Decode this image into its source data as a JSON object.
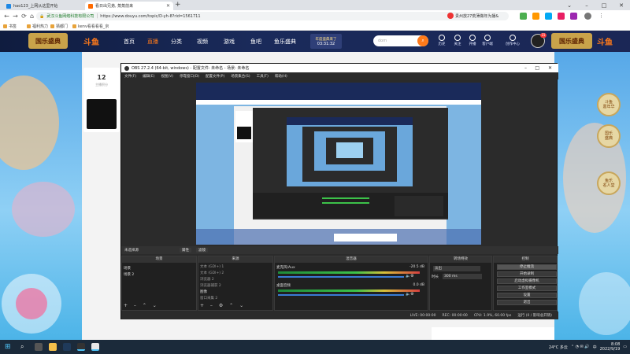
{
  "browser": {
    "tabs": [
      {
        "title": "hao123_上网从这里开始",
        "favicon_color": "#1e88e5",
        "active": false
      },
      {
        "title": "看日出兄弟, 蒸蒸前来",
        "favicon_color": "#ff6a00",
        "active": true
      }
    ],
    "new_tab": "+",
    "window_controls": [
      "⌄",
      "–",
      "□",
      "✕"
    ],
    "nav": {
      "back": "←",
      "forward": "→",
      "reload": "⟳",
      "home": "⌂"
    },
    "site_name": "武汉斗鱼网络科技有限公司",
    "url": "https://www.douyu.com/topic/D-yh-8?rid=1561711",
    "profile_badge": "贵州放27荒薄做年为播&",
    "bookmarks": [
      "书签",
      "福利热力",
      "猜都门",
      "kenv看看看看_京"
    ]
  },
  "douyu": {
    "logo": "斗鱼",
    "event_banner": "国乐盛典",
    "nav_items": [
      "首页",
      "直播",
      "分类",
      "视频",
      "游戏",
      "鱼吧",
      "鱼乐盛典"
    ],
    "promo_title": "年度盛典来了",
    "promo_time": "03:31:32",
    "search_placeholder": "dom",
    "header_icons": [
      {
        "label": "历史"
      },
      {
        "label": "关注"
      },
      {
        "label": "开播"
      },
      {
        "label": "客户端"
      },
      {
        "label": "创作中心"
      }
    ],
    "user_badge": "31",
    "card": {
      "number": "12",
      "label": "主播积分"
    },
    "side_badges": [
      "斗鱼\n嘉年华",
      "国乐\n盛典",
      "鱼乐\n名人堂"
    ]
  },
  "obs": {
    "title": "OBS 27.2.4 (64-bit, windows) - 配置文件: 未命名 - 场景: 未命名",
    "menu": [
      "文件(F)",
      "编辑(E)",
      "视图(V)",
      "停靠窗口(D)",
      "配置文件(P)",
      "场景集合(S)",
      "工具(T)",
      "帮助(H)"
    ],
    "scene_bar": {
      "label": "未选择源",
      "props": "属性",
      "filters": "滤镜"
    },
    "panels": {
      "scenes": {
        "header": "场景",
        "items": [
          "场景",
          "场景 2"
        ]
      },
      "sources": {
        "header": "来源",
        "items": [
          "文本 (GDI+) 1",
          "文本 (GDI+) 2",
          "浏览器 2",
          "浏览器捕获 2",
          "图像",
          "窗口采集 2"
        ]
      },
      "mixer": {
        "header": "混音器",
        "channels": [
          {
            "name": "麦克风/Aux",
            "db": "-20.5 dB"
          },
          {
            "name": "桌面音频",
            "db": "0.0 dB"
          }
        ]
      },
      "transitions": {
        "header": "转场特效",
        "type": "淡出",
        "duration_label": "时长",
        "duration": "300 ms"
      },
      "controls": {
        "header": "控制",
        "buttons": [
          "停止推流",
          "开始录制",
          "启动虚拟摄像机",
          "工作室模式",
          "设置",
          "退出"
        ]
      }
    },
    "status": {
      "live": "LIVE: 00:00:00",
      "rec": "REC: 00:00:00",
      "cpu": "CPU: 1.9%, 60.00 fps",
      "dropped": "运行 (0 / 影响总开销)"
    }
  },
  "taskbar": {
    "weather": "24°C 多云",
    "lang": "中",
    "time": "8:08",
    "date": "2022/9/19"
  }
}
